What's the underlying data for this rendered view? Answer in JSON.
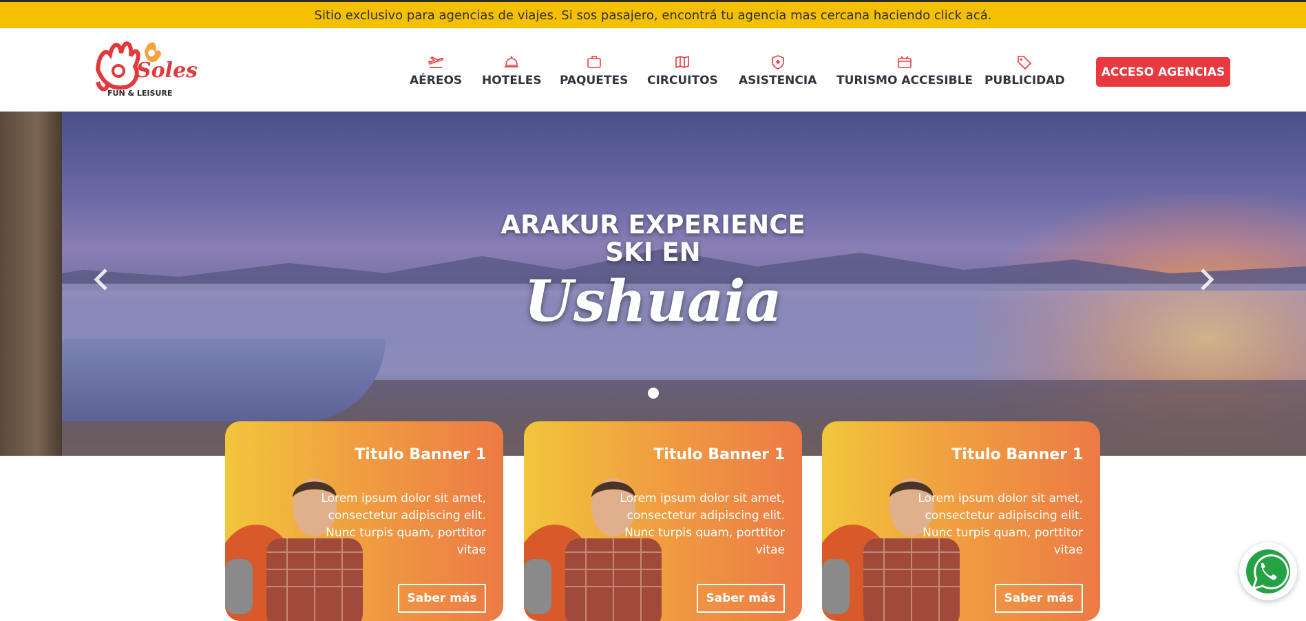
{
  "notice": {
    "text": "Sitio exclusivo para agencias de viajes. Si sos pasajero, encontrá tu agencia mas cercana haciendo click acá."
  },
  "logo": {
    "text": "Soles",
    "tagline": "FUN & LEISURE",
    "icon": "hand-logo-icon"
  },
  "nav": {
    "items": [
      {
        "label": "AÉREOS",
        "icon": "plane-icon"
      },
      {
        "label": "HOTELES",
        "icon": "bell-icon"
      },
      {
        "label": "PAQUETES",
        "icon": "suitcase-icon"
      },
      {
        "label": "CIRCUITOS",
        "icon": "map-icon"
      },
      {
        "label": "ASISTENCIA",
        "icon": "shield-icon"
      },
      {
        "label": "TURISMO ACCESIBLE",
        "icon": "wallet-icon"
      },
      {
        "label": "PUBLICIDAD",
        "icon": "tag-icon"
      }
    ],
    "cta": "ACCESO AGENCIAS"
  },
  "hero": {
    "line1": "ARAKUR EXPERIENCE",
    "line2": "SKI EN",
    "script": "Ushuaia"
  },
  "cards": [
    {
      "title": "Titulo Banner 1",
      "text": "Lorem ipsum dolor sit amet, consectetur adipiscing elit. Nunc turpis quam, porttitor vitae",
      "button": "Saber más"
    },
    {
      "title": "Titulo Banner 1",
      "text": "Lorem ipsum dolor sit amet, consectetur adipiscing elit. Nunc turpis quam, porttitor vitae",
      "button": "Saber más"
    },
    {
      "title": "Titulo Banner 1",
      "text": "Lorem ipsum dolor sit amet, consectetur adipiscing elit. Nunc turpis quam, porttitor vitae",
      "button": "Saber más"
    }
  ],
  "colors": {
    "notice": "#f5c000",
    "accent": "#e83a3e",
    "nav_icon": "#e83a3e",
    "nav_text": "#333540"
  }
}
